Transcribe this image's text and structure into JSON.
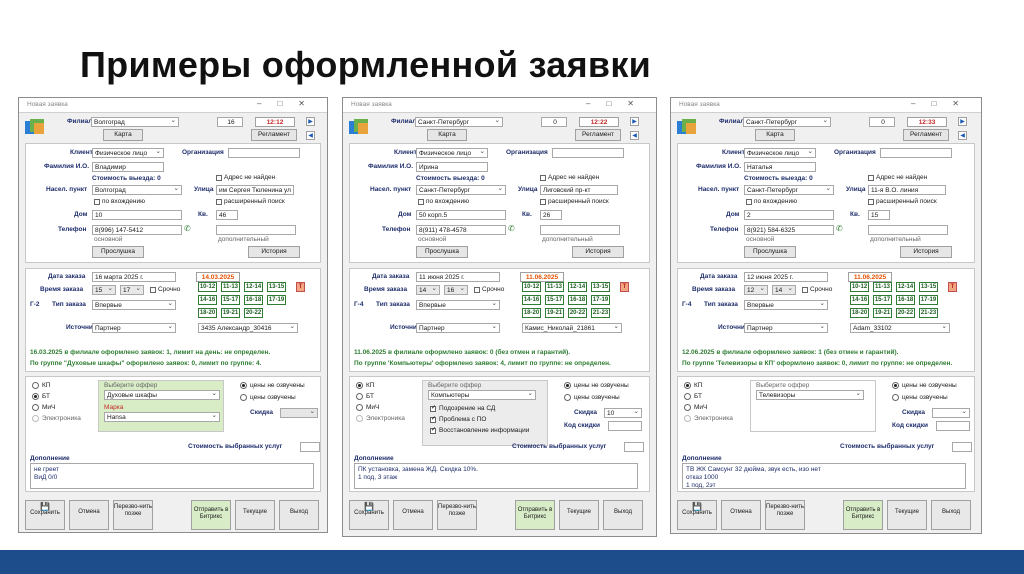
{
  "slide": {
    "title": "Примеры оформленной заявки"
  },
  "common": {
    "window_title": "Новая заявка",
    "filial_label": "Филиал",
    "map_button": "Карта",
    "reglament_button": "Регламент",
    "client_label": "Клиент",
    "org_label": "Организация",
    "fio_label": "Фамилия И.О.",
    "cost_label": "Стоимость выезда: 0",
    "addr_not_found": "Адрес не найден",
    "city_label": "Насел. пункт",
    "street_label": "Улица",
    "by_occurrence": "по вхождению",
    "extended_search": "расширенный поиск",
    "house_label": "Дом",
    "apt_label": "Кв.",
    "phone_label": "Телефон",
    "phone_main": "основной",
    "phone_extra": "дополнительный",
    "listen_button": "Прослушка",
    "history_button": "История",
    "order_date_label": "Дата заказа",
    "order_time_label": "Время заказа",
    "urgent_label": "Срочно",
    "order_type_label": "Тип заказа",
    "source_label": "Источник",
    "kp": "КП",
    "bt": "БТ",
    "mich": "МиЧ",
    "electronics": "Электроника",
    "choose_offer": "Выберите оффер",
    "prices_not_voiced": "цены не озвучены",
    "prices_voiced": "цены озвучены",
    "discount_label": "Скидка",
    "discount_code_label": "Код скидки",
    "brand_label": "Марка",
    "services_cost_label": "Стоимость выбранных услуг",
    "addition_label": "Дополнение",
    "save_button": "Сохранить",
    "cancel_button": "Отмена",
    "call_later_button": "Перезво-нить позже",
    "send_bitrix_button": "Отправить в Битрикс",
    "current_button": "Текущие",
    "exit_button": "Выход",
    "t_button": "Т"
  },
  "windows": [
    {
      "filial": "Волгоград",
      "counter": "16",
      "time": "12:12",
      "client": "Физическое лицо",
      "fio": "Владимир",
      "city": "Волгоград",
      "street": "им Сергея Тюленина ул",
      "house": "10",
      "apt": "46",
      "phone": "8(996) 147-5412",
      "order_day": "16",
      "order_month": "марта",
      "order_year": "2025 г.",
      "order_date_red": "14.03.2025",
      "time_from": "15",
      "time_to": "17",
      "group": "Г-2",
      "order_type": "Впервые",
      "source": "Партнер",
      "source_agent": "3435 Александр_30416",
      "slots": [
        "10-12",
        "11-13",
        "12-14",
        "13-15",
        "14-16",
        "15-17",
        "16-18",
        "17-19",
        "18-20",
        "19-21",
        "20-22"
      ],
      "info1": "16.03.2025 в филиале оформлено заявок: 1, лимит на день: не определен.",
      "info2": "По группе \"Духовые шкафы\" оформлено заявок: 0, лимит по группе: 4.",
      "offer": "Духовые шкафы",
      "brand": "Hansa",
      "addition": "не греет\nВиД 0/0"
    },
    {
      "filial": "Санкт-Петербург",
      "counter": "0",
      "time": "12:22",
      "client": "Физическое лицо",
      "fio": "Ирина",
      "city": "Санкт-Петербург",
      "street": "Лиговский пр-кт",
      "house": "50 корп.5",
      "apt": "26",
      "phone": "8(911) 478-4578",
      "order_day": "11",
      "order_month": "июня",
      "order_year": "2025 г.",
      "order_date_red": "11.06.2025",
      "time_from": "14",
      "time_to": "16",
      "group": "Г-4",
      "order_type": "Впервые",
      "source": "Партнер",
      "source_agent": "Камис_Николай_21861",
      "slots": [
        "10-12",
        "11-13",
        "12-14",
        "13-15",
        "14-16",
        "15-17",
        "16-18",
        "17-19",
        "18-20",
        "19-21",
        "20-22",
        "21-23"
      ],
      "info1": "11.06.2025 в филиале оформлено заявок: 0 (без отмен и гарантий).",
      "info2": "По группе 'Компьютеры' оформлено заявок: 4, лимит по группе: не определен.",
      "offer": "Компьютеры",
      "checks": [
        "Подозрение на СД",
        "Проблема с ПО",
        "Восстановление информации"
      ],
      "discount": "10",
      "addition": "ПК установка, замена ЖД. Скидка 10%.\n1 под, 3 этаж"
    },
    {
      "filial": "Санкт-Петербург",
      "counter": "0",
      "time": "12:33",
      "client": "Физическое лицо",
      "fio": "Наталья",
      "city": "Санкт-Петербург",
      "street": "11-я В.О. линия",
      "house": "2",
      "apt": "15",
      "phone": "8(921) 584-6325",
      "order_day": "12",
      "order_month": "июня",
      "order_year": "2025 г.",
      "order_date_red": "11.06.2025",
      "time_from": "12",
      "time_to": "14",
      "group": "Г-4",
      "order_type": "Впервые",
      "source": "Партнер",
      "source_agent": "Adam_33102",
      "slots": [
        "10-12",
        "11-13",
        "12-14",
        "13-15",
        "14-16",
        "15-17",
        "16-18",
        "17-19",
        "18-20",
        "19-21",
        "20-22",
        "21-23"
      ],
      "info1": "12.06.2025 в филиале оформлено заявок: 1 (без отмен и гарантий).",
      "info2": "По группе 'Телевизоры в КП' оформлено заявок: 0, лимит по группе: не определен.",
      "offer": "Телевизоры",
      "addition": "ТВ ЖК Самсунг 32 дюйма, звук есть, изо нет\nотказ 1000\n1 под, 2эт"
    }
  ]
}
